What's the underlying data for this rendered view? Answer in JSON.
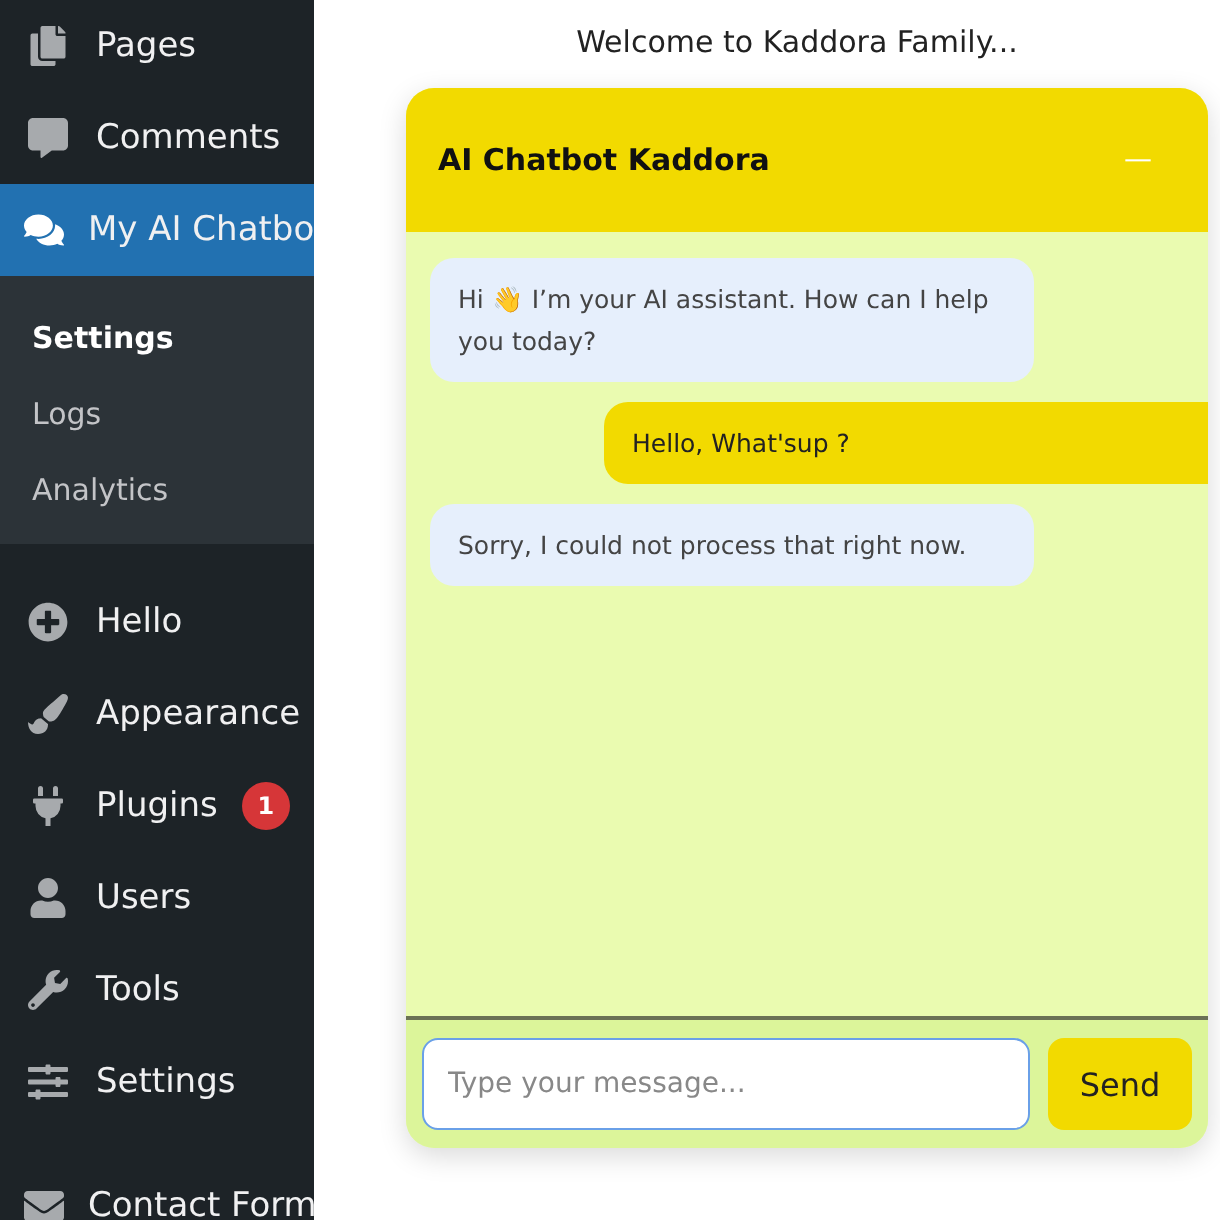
{
  "sidebar": {
    "items": [
      {
        "label": "Pages",
        "selected": false
      },
      {
        "label": "Comments",
        "selected": false
      },
      {
        "label": "My AI Chatbo",
        "selected": true,
        "submenu": [
          {
            "label": "Settings",
            "selected": true
          },
          {
            "label": "Logs",
            "selected": false
          },
          {
            "label": "Analytics",
            "selected": false
          }
        ]
      },
      {
        "label": "Hello",
        "selected": false
      },
      {
        "label": "Appearance",
        "selected": false
      },
      {
        "label": "Plugins",
        "selected": false,
        "badge": "1"
      },
      {
        "label": "Users",
        "selected": false
      },
      {
        "label": "Tools",
        "selected": false
      },
      {
        "label": "Settings",
        "selected": false
      },
      {
        "label": "Contact Form",
        "selected": false
      }
    ]
  },
  "welcome": "Welcome to Kaddora Family...",
  "chat": {
    "title": "AI Chatbot Kaddora",
    "minimize": "—",
    "messages": [
      {
        "kind": "bot",
        "text": "Hi 👋 I’m your AI assistant. How can I help you today?"
      },
      {
        "kind": "user",
        "text": "Hello, What'sup ?"
      },
      {
        "kind": "bot",
        "text": "Sorry, I could not process that right now."
      }
    ],
    "input": {
      "placeholder": "Type your message..."
    },
    "send": "Send"
  }
}
